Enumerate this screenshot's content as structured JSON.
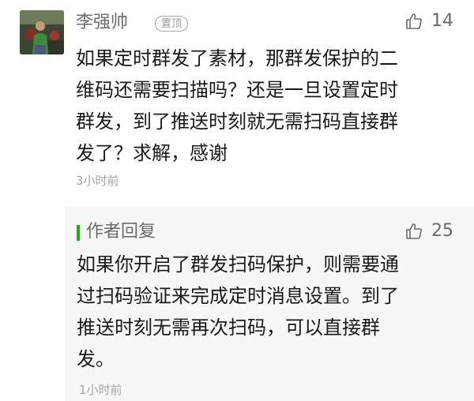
{
  "comment": {
    "avatar_icon": "user-photo",
    "author": "李强帅",
    "pinned_label": "置顶",
    "likes": "14",
    "text": "如果定时群发了素材，那群发保护的二\n维码还需要扫描吗？还是一旦设置定时\n群发，到了推送时刻就无需扫码直接群\n发了？求解，感谢",
    "time": "3小时前"
  },
  "reply": {
    "title": "作者回复",
    "likes": "25",
    "text": "如果你开启了群发扫码保护，则需要通\n过扫码验证来完成定时消息设置。到了\n推送时刻无需再次扫码，可以直接群\n发。",
    "time": "1小时前"
  },
  "colors": {
    "accent_green": "#1aad19",
    "reply_bg": "#f7f7f7",
    "meta_gray": "#a6a6a6"
  }
}
